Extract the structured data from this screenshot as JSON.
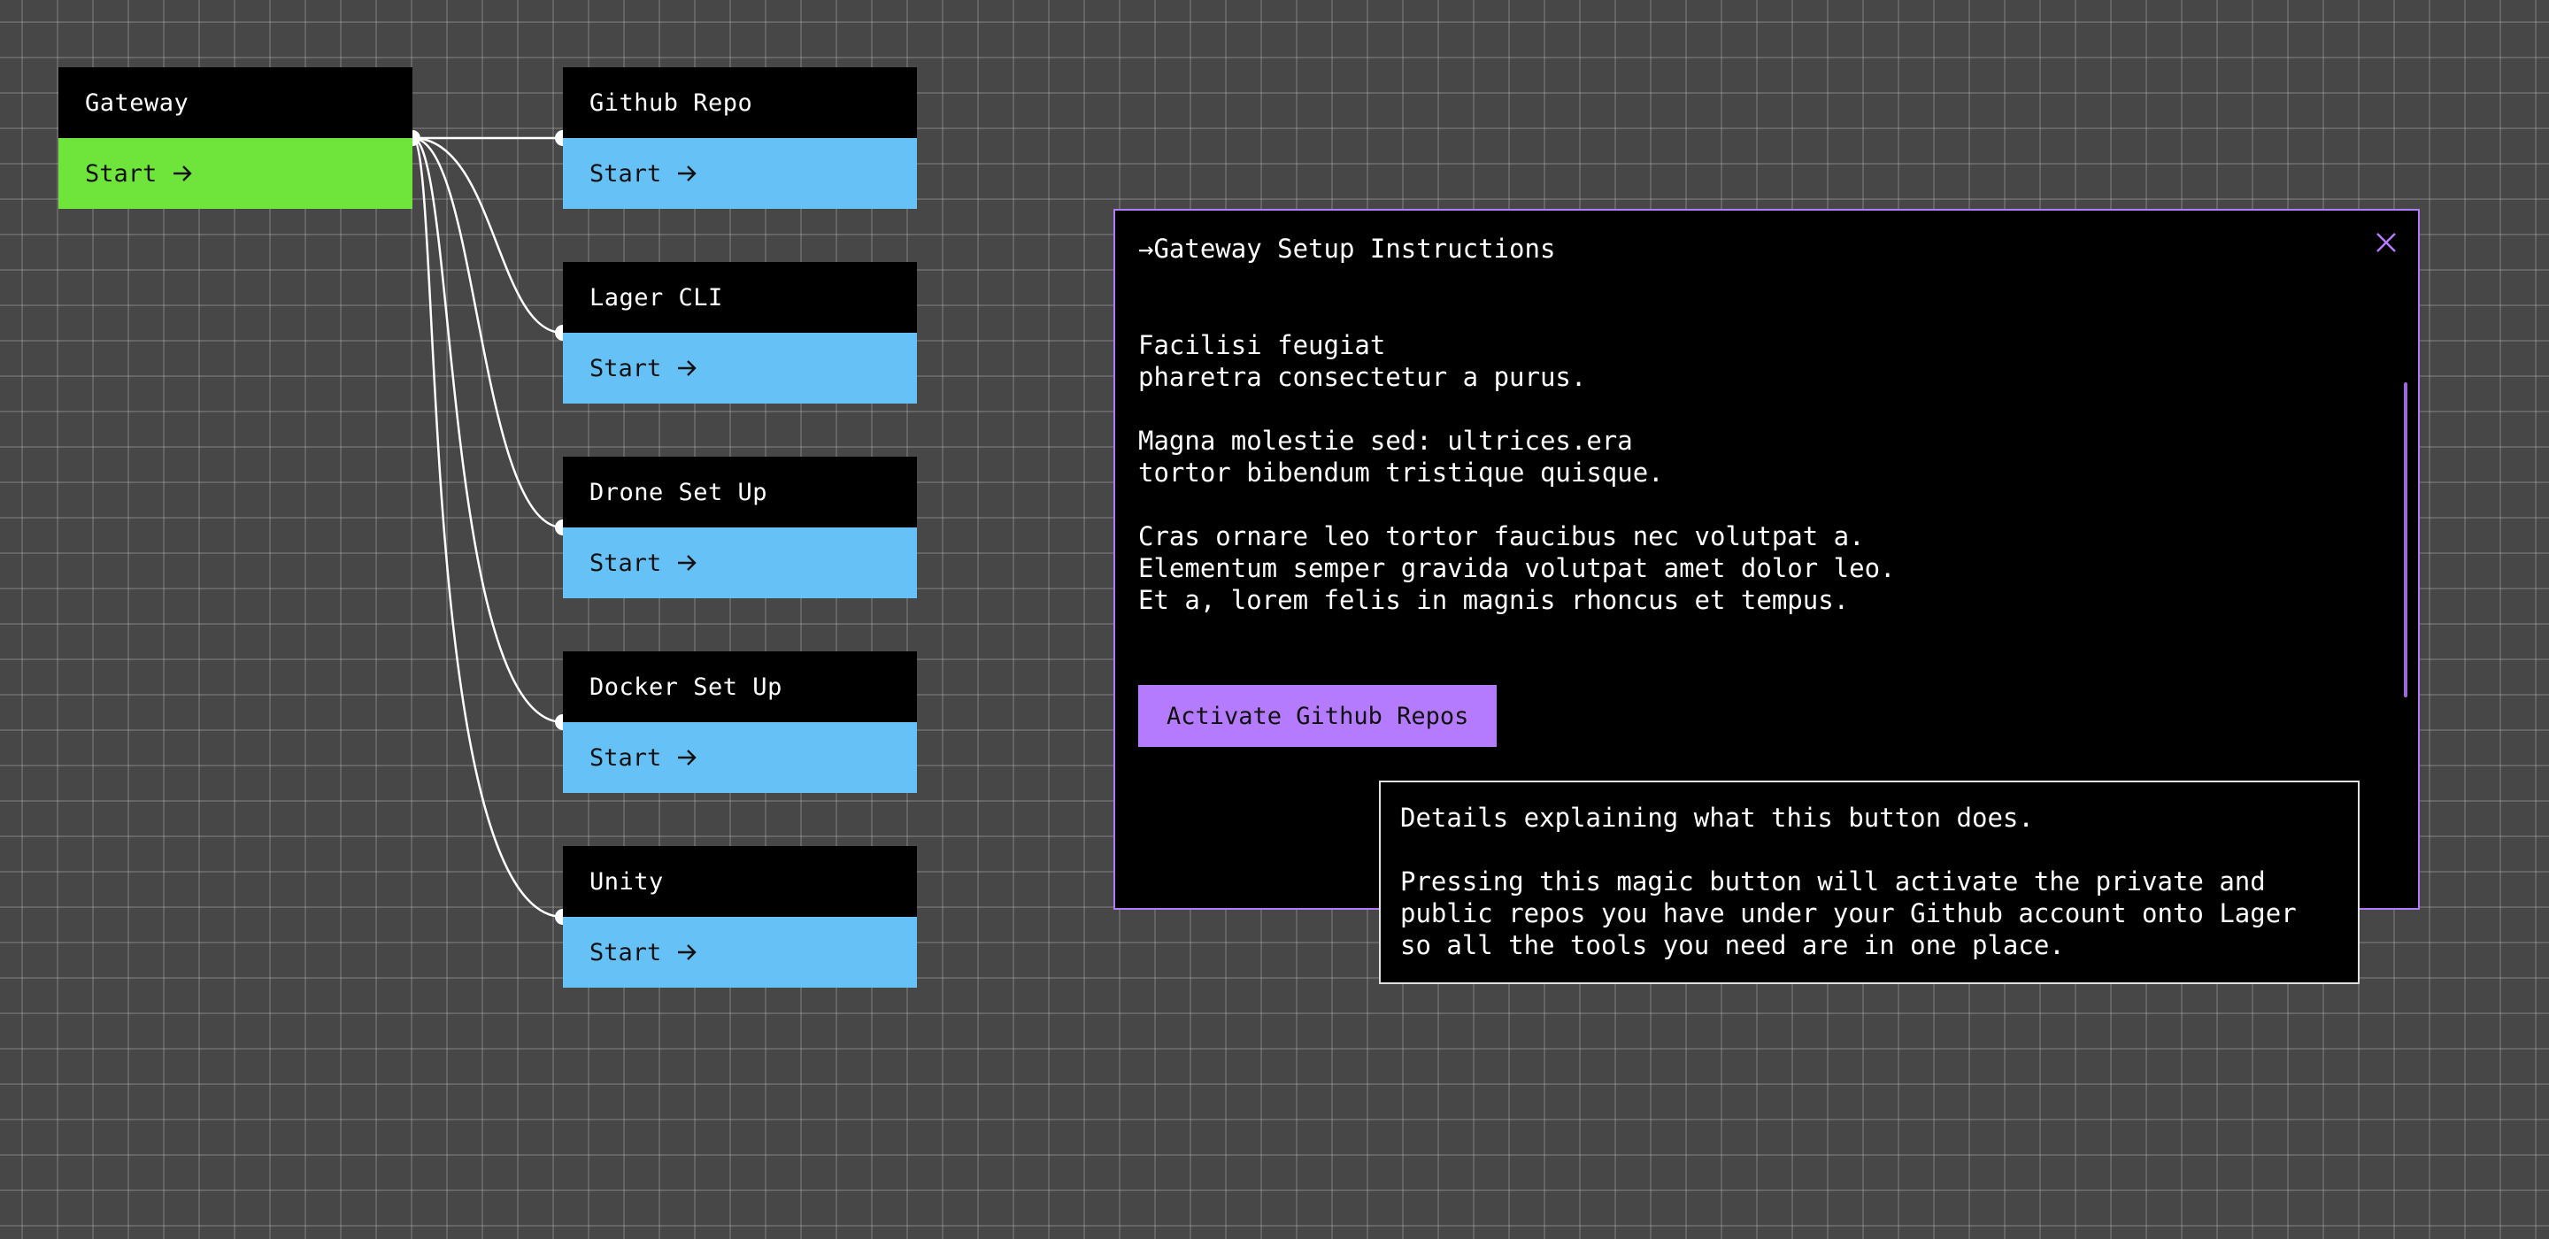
{
  "nodes": [
    {
      "id": "gateway",
      "title": "Gateway",
      "start_label": "Start",
      "color": "#6fe53c"
    },
    {
      "id": "github-repo",
      "title": "Github Repo",
      "start_label": "Start",
      "color": "#66c1f6"
    },
    {
      "id": "lager-cli",
      "title": "Lager CLI",
      "start_label": "Start",
      "color": "#66c1f6"
    },
    {
      "id": "drone-set-up",
      "title": "Drone Set Up",
      "start_label": "Start",
      "color": "#66c1f6"
    },
    {
      "id": "docker-set-up",
      "title": "Docker Set Up",
      "start_label": "Start",
      "color": "#66c1f6"
    },
    {
      "id": "unity",
      "title": "Unity",
      "start_label": "Start",
      "color": "#66c1f6"
    }
  ],
  "icons": {
    "start_arrow": "arrow-right-icon",
    "close": "close-icon"
  },
  "panel": {
    "title": "→Gateway Setup Instructions",
    "paragraphs": [
      [
        "Facilisi feugiat",
        "pharetra consectetur a purus."
      ],
      [
        "Magna molestie sed: ultrices.era",
        "tortor bibendum tristique quisque."
      ],
      [
        "Cras ornare leo tortor faucibus nec volutpat a.",
        "Elementum semper gravida volutpat amet dolor leo.",
        "Et a, lorem felis in magnis rhoncus et tempus."
      ]
    ],
    "button_label": "Activate Github Repos",
    "accent_color": "#b57bff"
  },
  "tooltip": {
    "heading": "Details explaining what this button does.",
    "lines": [
      "Pressing this magic button will activate the private and",
      "public repos you have under your Github account onto Lager",
      "so all the tools you need are in one place."
    ]
  }
}
